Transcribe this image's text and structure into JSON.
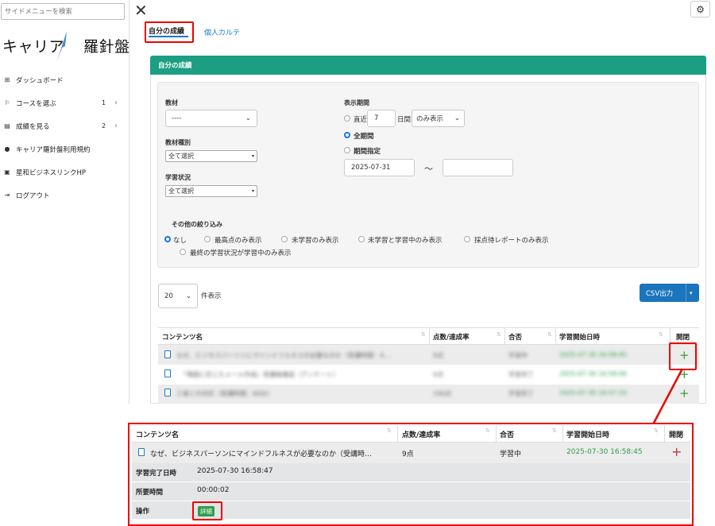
{
  "sidebar": {
    "search_placeholder": "サイドメニューを検索",
    "logo_text_left": "キャリア",
    "logo_text_right": "羅針盤",
    "items": [
      {
        "icon": "grid-icon",
        "label": "ダッシュボード",
        "count": "",
        "chevron": false
      },
      {
        "icon": "flag-icon",
        "label": "コースを選ぶ",
        "count": "1",
        "chevron": true
      },
      {
        "icon": "chart-icon",
        "label": "成績を見る",
        "count": "2",
        "chevron": true
      },
      {
        "icon": "user-plus-icon",
        "label": "キャリア羅針盤利用規約",
        "count": "",
        "chevron": false
      },
      {
        "icon": "window-icon",
        "label": "星和ビジネスリンクHP",
        "count": "",
        "chevron": false
      },
      {
        "icon": "logout-icon",
        "label": "ログアウト",
        "count": "",
        "chevron": false
      }
    ]
  },
  "tabs": {
    "active": "自分の成績",
    "inactive": "個人カルテ"
  },
  "panel": {
    "title": "自分の成績"
  },
  "filters": {
    "material_label": "教材",
    "material_value": "----",
    "material_type_label": "教材種別",
    "material_type_value": "全て選択",
    "status_label": "学習状況",
    "status_value": "全て選択",
    "period_label": "表示期間",
    "recent_label": "直近",
    "recent_days": "7",
    "days_unit": "日間",
    "only_show": "のみ表示",
    "all_period": "全期間",
    "period_specify": "期間指定",
    "date_from": "2025-07-31",
    "tilde": "～",
    "date_to": "",
    "other_label": "その他の絞り込み",
    "other_options": [
      "なし",
      "最高点のみ表示",
      "未学習のみ表示",
      "未学習と学習中のみ表示",
      "採点待レポートのみ表示"
    ],
    "other_option_last": "最終の学習状況が学習中のみ表示"
  },
  "controls": {
    "page_size": "20",
    "page_size_suffix": "件表示",
    "csv_label": "CSV出力"
  },
  "table": {
    "headers": [
      "コンテンツ名",
      "点数/達成率",
      "合否",
      "学習開始日時",
      "開閉"
    ],
    "rows": [
      {
        "name": "なぜ、ビジネスパーソンにマインドフルネスが必要なのか（受講時間：4…",
        "score": "9点",
        "result": "学習中",
        "start": "2025-07-30 16:58:45",
        "toggle": "+"
      },
      {
        "name": "「場面に応じたメール作成」受講後確認（アンケート）",
        "score": "0点",
        "result": "学習完了",
        "start": "2025-07-30 16:58:06",
        "toggle": "+"
      },
      {
        "name": "三者との対応（受講時間：60分）",
        "score": "100点",
        "result": "学習完了",
        "start": "2025-07-30 16:57:33",
        "toggle": "+"
      }
    ]
  },
  "zoom": {
    "headers": [
      "コンテンツ名",
      "点数/達成率",
      "合否",
      "学習開始日時",
      "開閉"
    ],
    "row": {
      "name": "なぜ、ビジネスパーソンにマインドフルネスが必要なのか（受講時…",
      "score": "9点",
      "result": "学習中",
      "start": "2025-07-30 16:58:45",
      "toggle": "+"
    },
    "details": [
      {
        "label": "学習完了日時",
        "value": "2025-07-30 16:58:47"
      },
      {
        "label": "所要時間",
        "value": "00:00:02"
      },
      {
        "label": "操作",
        "value": ""
      }
    ],
    "detail_button": "詳細"
  },
  "colors": {
    "accent": "#1c9e83",
    "highlight": "#e00000",
    "link": "#1b7ac1",
    "csv_button": "#1b75bc",
    "green_text": "#2e9e4a"
  }
}
